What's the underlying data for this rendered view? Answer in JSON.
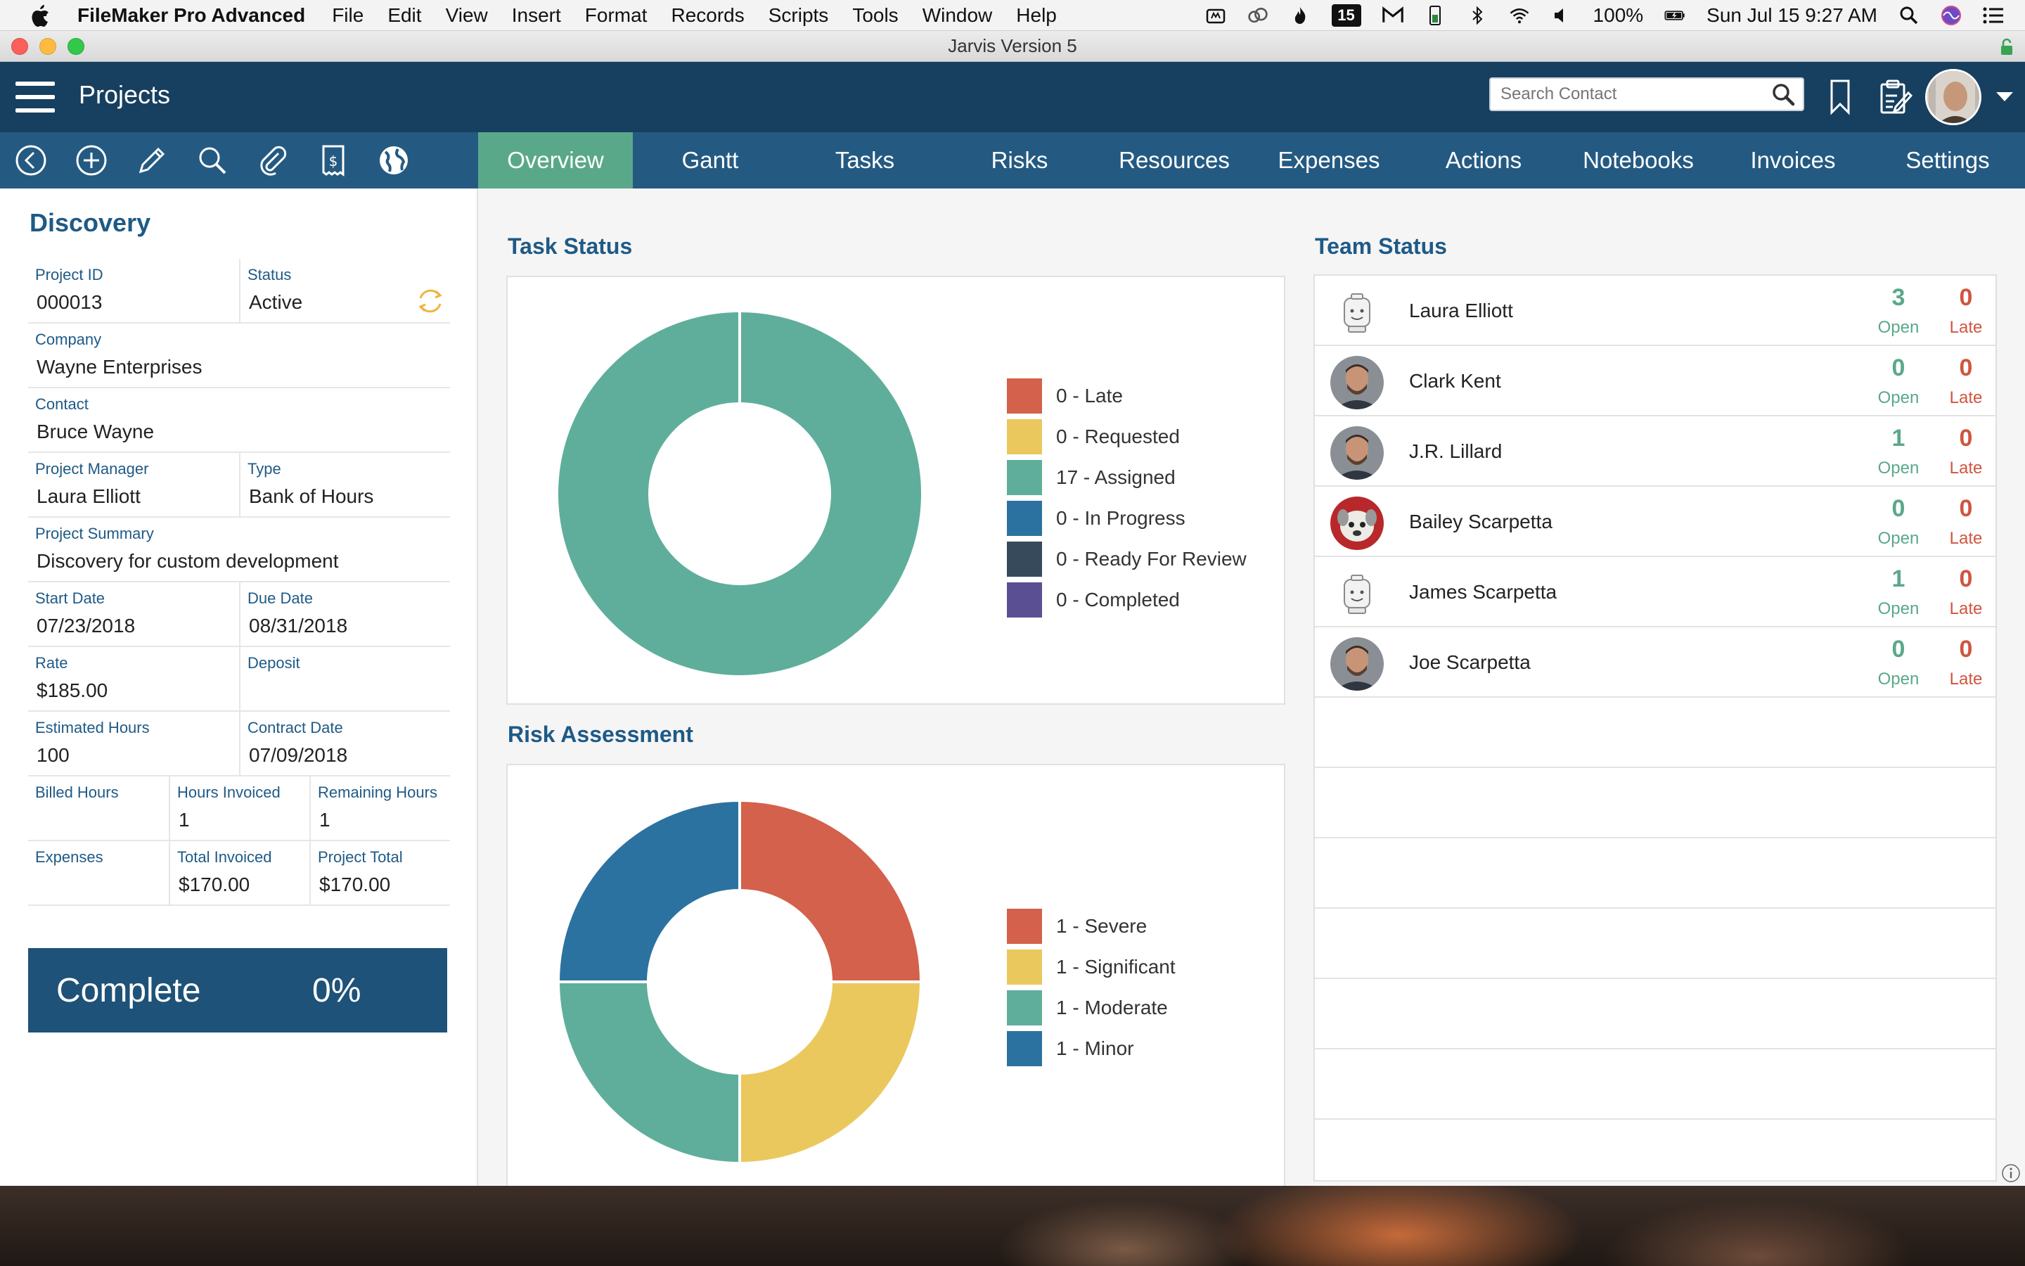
{
  "menubar": {
    "app_name": "FileMaker Pro Advanced",
    "items": [
      "File",
      "Edit",
      "View",
      "Insert",
      "Format",
      "Records",
      "Scripts",
      "Tools",
      "Window",
      "Help"
    ],
    "calendar_day": "15",
    "battery": "100%",
    "datetime": "Sun Jul 15  9:27 AM"
  },
  "window": {
    "title": "Jarvis Version 5"
  },
  "header": {
    "title": "Projects",
    "search_placeholder": "Search Contact"
  },
  "tabs": [
    {
      "label": "Overview",
      "active": true
    },
    {
      "label": "Gantt"
    },
    {
      "label": "Tasks"
    },
    {
      "label": "Risks"
    },
    {
      "label": "Resources"
    },
    {
      "label": "Expenses"
    },
    {
      "label": "Actions"
    },
    {
      "label": "Notebooks"
    },
    {
      "label": "Invoices"
    },
    {
      "label": "Settings"
    }
  ],
  "toolbar_icons": [
    "back-icon",
    "add-icon",
    "edit-icon",
    "search-icon",
    "attach-icon",
    "invoice-icon",
    "globe-icon"
  ],
  "project": {
    "title": "Discovery",
    "project_id": {
      "label": "Project ID",
      "value": "000013"
    },
    "status": {
      "label": "Status",
      "value": "Active"
    },
    "company": {
      "label": "Company",
      "value": "Wayne Enterprises"
    },
    "contact": {
      "label": "Contact",
      "value": "Bruce Wayne"
    },
    "project_manager": {
      "label": "Project Manager",
      "value": "Laura Elliott"
    },
    "type": {
      "label": "Type",
      "value": "Bank of Hours"
    },
    "summary": {
      "label": "Project Summary",
      "value": "Discovery for custom development"
    },
    "start_date": {
      "label": "Start Date",
      "value": "07/23/2018"
    },
    "due_date": {
      "label": "Due Date",
      "value": "08/31/2018"
    },
    "rate": {
      "label": "Rate",
      "value": "$185.00"
    },
    "deposit": {
      "label": "Deposit",
      "value": ""
    },
    "estimated_hours": {
      "label": "Estimated Hours",
      "value": "100"
    },
    "contract_date": {
      "label": "Contract Date",
      "value": "07/09/2018"
    },
    "billed_hours": {
      "label": "Billed Hours",
      "value": ""
    },
    "hours_invoiced": {
      "label": "Hours Invoiced",
      "value": "1"
    },
    "remaining_hours": {
      "label": "Remaining Hours",
      "value": "1"
    },
    "expenses": {
      "label": "Expenses",
      "value": ""
    },
    "total_invoiced": {
      "label": "Total Invoiced",
      "value": "$170.00"
    },
    "project_total": {
      "label": "Project Total",
      "value": "$170.00"
    },
    "complete_label": "Complete",
    "complete_value": "0%"
  },
  "task_status": {
    "title": "Task Status",
    "chart_data": {
      "type": "pie",
      "categories": [
        "Late",
        "Requested",
        "Assigned",
        "In Progress",
        "Ready For Review",
        "Completed"
      ],
      "values": [
        0,
        0,
        17,
        0,
        0,
        0
      ],
      "legend": [
        "0 - Late",
        "0 - Requested",
        "17 - Assigned",
        "0 - In Progress",
        "0 - Ready For Review",
        "0 - Completed"
      ],
      "colors": [
        "#d3614b",
        "#ebc85e",
        "#5fae9b",
        "#2c72a0",
        "#364a5c",
        "#5b4f94"
      ]
    }
  },
  "risk_assessment": {
    "title": "Risk Assessment",
    "chart_data": {
      "type": "pie",
      "categories": [
        "Severe",
        "Significant",
        "Moderate",
        "Minor"
      ],
      "values": [
        1,
        1,
        1,
        1
      ],
      "legend": [
        "1 - Severe",
        "1 - Significant",
        "1 - Moderate",
        "1 - Minor"
      ],
      "colors": [
        "#d3614b",
        "#ebc85e",
        "#5fae9b",
        "#2c72a0"
      ]
    }
  },
  "team_status": {
    "title": "Team Status",
    "open_label": "Open",
    "late_label": "Late",
    "members": [
      {
        "name": "Laura Elliott",
        "open": "3",
        "late": "0",
        "avatar": "placeholder"
      },
      {
        "name": "Clark Kent",
        "open": "0",
        "late": "0",
        "avatar": "photo"
      },
      {
        "name": "J.R. Lillard",
        "open": "1",
        "late": "0",
        "avatar": "photo"
      },
      {
        "name": "Bailey Scarpetta",
        "open": "0",
        "late": "0",
        "avatar": "dog"
      },
      {
        "name": "James Scarpetta",
        "open": "1",
        "late": "0",
        "avatar": "placeholder"
      },
      {
        "name": "Joe Scarpetta",
        "open": "0",
        "late": "0",
        "avatar": "photo"
      }
    ]
  }
}
